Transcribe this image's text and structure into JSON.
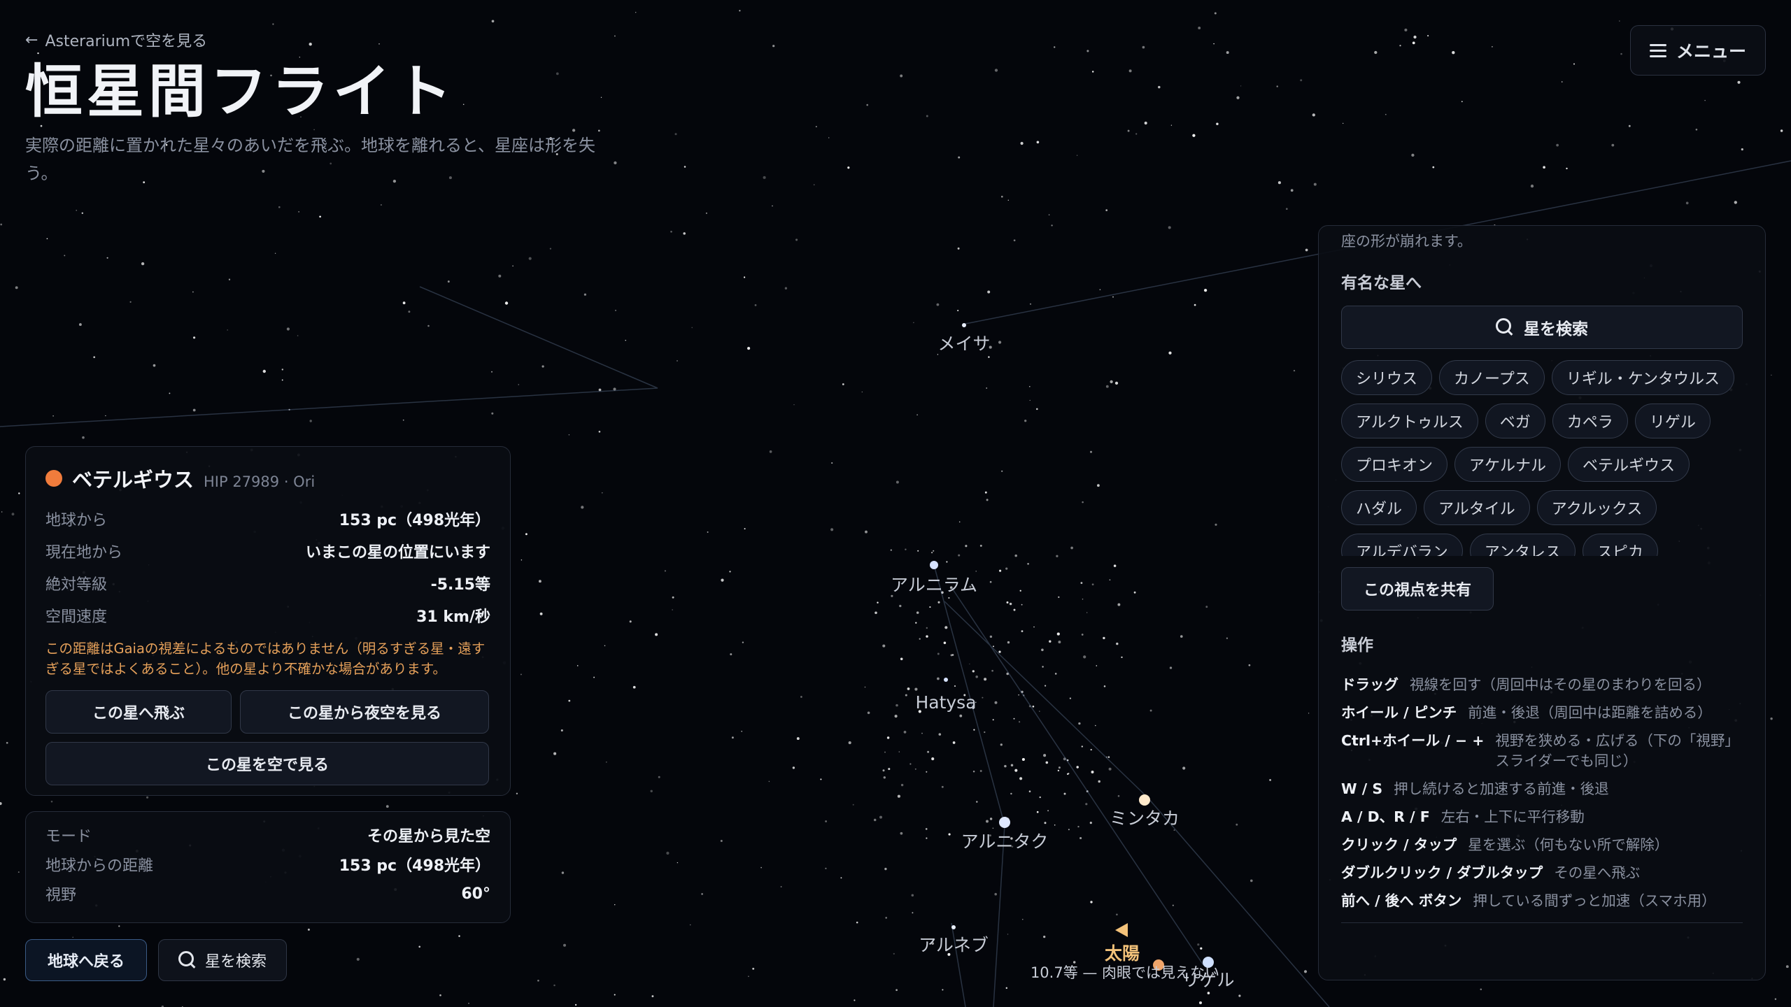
{
  "header": {
    "back_label": "Asterariumで空を見る",
    "title": "恒星間フライト",
    "subtitle": "実際の距離に置かれた星々のあいだを飛ぶ。地球を離れると、星座は形を失う。"
  },
  "menu": {
    "label": "メニュー"
  },
  "sky_labels": {
    "meissa": "メイサ",
    "alnilam": "アルニラム",
    "hatysa": "Hatysa",
    "alnitak": "アルニタク",
    "mintaka": "ミンタカ",
    "alnair": "アルネブ",
    "sun": "太陽",
    "sun_note": "10.7等 — 肉眼では見えない",
    "rigel_partial": "リゲル"
  },
  "star_card": {
    "name": "ベテルギウス",
    "id": "HIP 27989 · Ori",
    "dot_color": "#f07c3c",
    "rows": [
      {
        "k": "地球から",
        "v": "153 pc（498光年）"
      },
      {
        "k": "現在地から",
        "v": "いまこの星の位置にいます"
      },
      {
        "k": "絶対等級",
        "v": "-5.15等"
      },
      {
        "k": "空間速度",
        "v": "31 km/秒"
      }
    ],
    "warning": "この距離はGaiaの視差によるものではありません（明るすぎる星・遠すぎる星ではよくあること）。他の星より不確かな場合があります。",
    "fly_btn": "この星へ飛ぶ",
    "night_btn": "この星から夜空を見る",
    "sky_btn": "この星を空で見る"
  },
  "mode_card": {
    "rows": [
      {
        "k": "モード",
        "v": "その星から見た空"
      },
      {
        "k": "地球からの距離",
        "v": "153 pc（498光年）"
      },
      {
        "k": "視野",
        "v": "60°"
      }
    ]
  },
  "bottom": {
    "earth_btn": "地球へ戻る",
    "search_btn": "星を検索"
  },
  "side": {
    "cut_text": "座の形が崩れます。",
    "famous_title": "有名な星へ",
    "search_label": "星を検索",
    "chips": [
      "シリウス",
      "カノープス",
      "リギル・ケンタウルス",
      "アルクトゥルス",
      "ベガ",
      "カペラ",
      "リゲル",
      "プロキオン",
      "アケルナル",
      "ベテルギウス",
      "ハダル",
      "アルタイル",
      "アクルックス",
      "アルデバラン",
      "アンタレス",
      "スピカ"
    ],
    "share_btn": "この視点を共有",
    "ops_title": "操作",
    "ops": [
      {
        "key": "ドラッグ",
        "desc": "視線を回す（周回中はその星のまわりを回る）"
      },
      {
        "key": "ホイール / ピンチ",
        "desc": "前進・後退（周回中は距離を詰める）"
      },
      {
        "key": "Ctrl+ホイール / − +",
        "desc": "視野を狭める・広げる（下の「視野」スライダーでも同じ）"
      },
      {
        "key": "W / S",
        "desc": "押し続けると加速する前進・後退"
      },
      {
        "key": "A / D、R / F",
        "desc": "左右・上下に平行移動"
      },
      {
        "key": "クリック / タップ",
        "desc": "星を選ぶ（何もない所で解除）"
      },
      {
        "key": "ダブルクリック / ダブルタップ",
        "desc": "その星へ飛ぶ"
      },
      {
        "key": "前へ / 後へ ボタン",
        "desc": "押している間ずっと加速（スマホ用）"
      }
    ]
  },
  "colors": {
    "sun": "#f3c27a",
    "accent_orange": "#f07c3c",
    "warning": "#e6a15a"
  }
}
